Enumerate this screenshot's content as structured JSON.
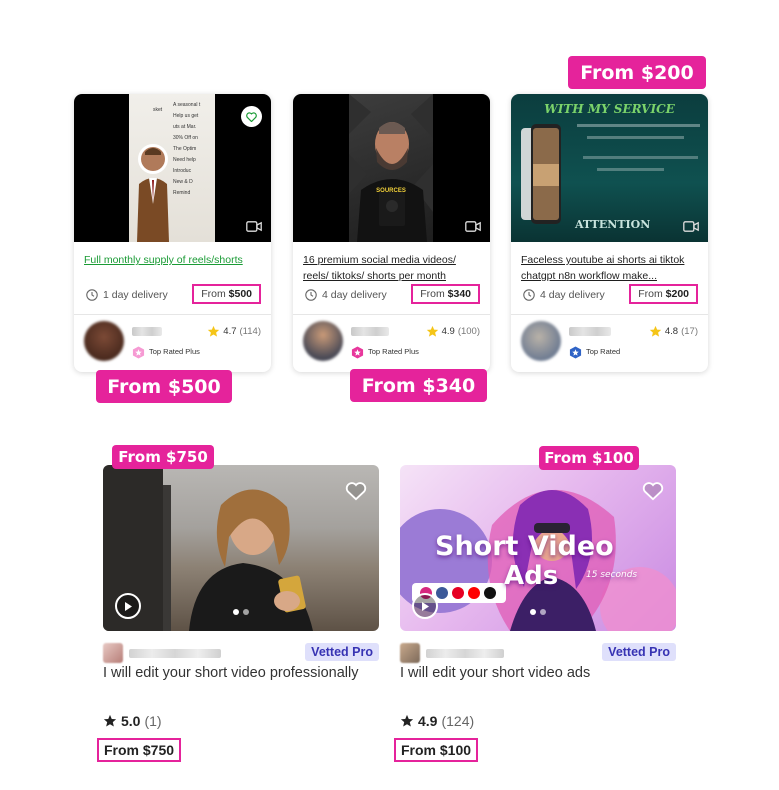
{
  "callouts": {
    "card3": "From $200",
    "card1": "From $500",
    "card2": "From $340",
    "bottom1": "From $750",
    "bottom2": "From $100"
  },
  "gigs": [
    {
      "title": "Full monthly supply of reels/shorts",
      "delivery": "1 day delivery",
      "price_prefix": "From ",
      "price": "$500",
      "rating": "4.7",
      "reviews": "(114)",
      "badge": "Top Rated Plus",
      "thumb_overlay_lines": [
        "sket",
        "A seasonal t",
        "Help us get",
        "uts at Mar.",
        "30% Off on",
        "The Optim",
        "Need help",
        "Introduc",
        "New & D",
        "Remind"
      ]
    },
    {
      "title": "16 premium social media videos/ reels/ tiktoks/ shorts per month",
      "delivery": "4 day delivery",
      "price_prefix": "From ",
      "price": "$340",
      "rating": "4.9",
      "reviews": "(100)",
      "badge": "Top Rated Plus",
      "thumb_caption": "SOURCES"
    },
    {
      "title": "Faceless youtube ai shorts ai tiktok chatgpt n8n workflow make...",
      "delivery": "4 day delivery",
      "price_prefix": "From ",
      "price": "$200",
      "rating": "4.8",
      "reviews": "(17)",
      "badge": "Top Rated",
      "thumb_headline": "WITH MY SERVICE",
      "thumb_footer": "ATTENTION"
    }
  ],
  "bottom_gigs": [
    {
      "badge": "Vetted Pro",
      "title": "I will edit your short video professionally",
      "rating": "5.0",
      "reviews": "(1)",
      "price": "From $750"
    },
    {
      "badge": "Vetted Pro",
      "title": "I will edit your short video ads",
      "rating": "4.9",
      "reviews": "(124)",
      "price": "From $100",
      "thumb_line1": "Short Video",
      "thumb_line2": "Ads",
      "thumb_sub": "15 seconds"
    }
  ],
  "colors": {
    "accent_pink": "#e5239b",
    "link_green": "#1a9b35",
    "vetted_bg": "#dfe0fb",
    "vetted_text": "#3733b3",
    "star": "#f5c518"
  },
  "icons": [
    "clock-icon",
    "star-icon",
    "heart-icon",
    "video-camera-icon",
    "play-icon",
    "top-rated-badge-icon"
  ]
}
